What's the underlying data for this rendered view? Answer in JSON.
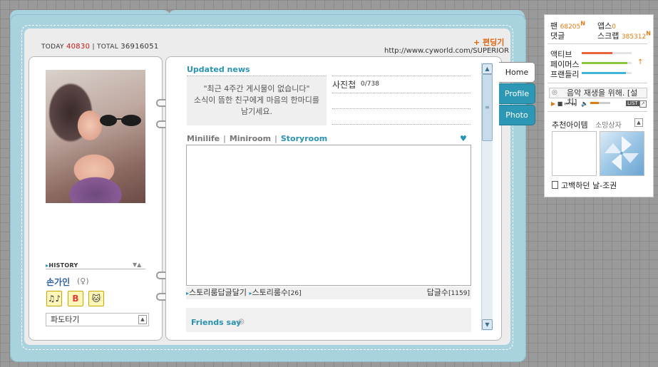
{
  "counter": {
    "today_label": "TODAY",
    "today": "40830",
    "sep": "|",
    "total_label": "TOTAL",
    "total": "36916051"
  },
  "edit_link": "+ 편딩기",
  "url": "http://www.cyworld.com/SUPERIOR",
  "left": {
    "history_label": "HISTORY",
    "name": "손가인",
    "gender": "(♀)",
    "icon_buttons": [
      "♫♪",
      "B",
      "🐱"
    ],
    "select_value": "파도타기"
  },
  "updated": {
    "title": "Updated news",
    "line1": "\"최근 4주간 게시물이 없습니다\"",
    "line2": "소식이 뜸한 친구에게 마음의 한마디를",
    "line3": "남기세요."
  },
  "photo_album": {
    "label": "사진첩",
    "count": "0/738"
  },
  "tabs": {
    "t1": "Minilife",
    "t2": "Miniroom",
    "t3": "Storyroom",
    "sep": "|"
  },
  "story_bar": {
    "reply": "스토리룸답글달기",
    "count_label": "스토리룸수",
    "count": "[26]",
    "answer_label": "답글수",
    "answer": "[1159]"
  },
  "friends_say": "Friends say",
  "side_tabs": {
    "home": "Home",
    "profile": "Profile",
    "photo": "Photo"
  },
  "stats": {
    "fan_label": "팬",
    "fan": "68205",
    "apps_label": "앱스",
    "apps": "0",
    "comment_label": "댓글",
    "scrap_label": "스크랩",
    "scrap": "385312",
    "new_mark": "N"
  },
  "meters": [
    {
      "label": "액티브",
      "value": 0.62,
      "color": "#e8643a"
    },
    {
      "label": "페이머스",
      "value": 0.92,
      "color": "#8cc63f"
    },
    {
      "label": "프랜들리",
      "value": 0.88,
      "color": "#3fb4d6"
    }
  ],
  "music": {
    "text": "음악 재생을 위해. [설치]",
    "list": "LIST"
  },
  "recommend": {
    "title": "추천아이템",
    "wish": "소망상자"
  },
  "song": "고백하던 날-조권"
}
